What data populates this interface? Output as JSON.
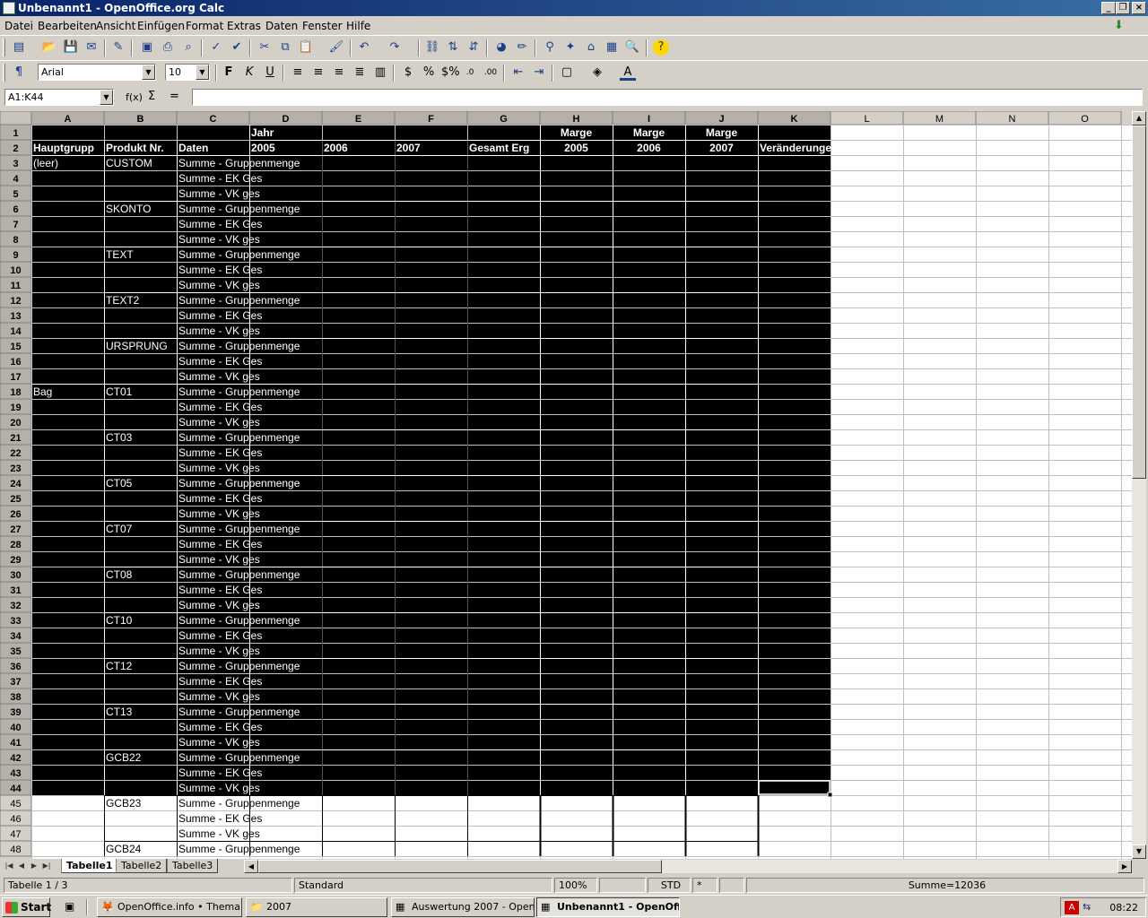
{
  "window": {
    "title": "Unbenannt1 - OpenOffice.org Calc"
  },
  "menu": [
    "Datei",
    "Bearbeiten",
    "Ansicht",
    "Einfügen",
    "Format",
    "Extras",
    "Daten",
    "Fenster",
    "Hilfe"
  ],
  "formatting": {
    "font_name": "Arial",
    "font_size": "10"
  },
  "formula_bar": {
    "name_box": "A1:K44",
    "function_wizard": "f(x)",
    "sum_symbol": "Σ",
    "equals_symbol": "=",
    "input": ""
  },
  "grid": {
    "columns": [
      "A",
      "B",
      "C",
      "D",
      "E",
      "F",
      "G",
      "H",
      "I",
      "J",
      "K",
      "L",
      "M",
      "N",
      "O"
    ],
    "rows": [
      "1",
      "2",
      "3",
      "4",
      "5",
      "6",
      "7",
      "8",
      "9",
      "10",
      "11",
      "12",
      "13",
      "14",
      "15",
      "16",
      "17",
      "18",
      "19",
      "20",
      "21",
      "22",
      "23",
      "24",
      "25",
      "26",
      "27",
      "28",
      "29",
      "30",
      "31",
      "32",
      "33",
      "34",
      "35",
      "36",
      "37",
      "38",
      "39",
      "40",
      "41",
      "42",
      "43",
      "44",
      "45",
      "46",
      "47",
      "48"
    ],
    "selection": "A1:K44",
    "header_row1": {
      "D": "Jahr",
      "H": "Marge",
      "I": "Marge",
      "J": "Marge"
    },
    "header_row2": {
      "A": "Hauptgrupp",
      "B": "Produkt Nr.",
      "C": "Daten",
      "D": "2005",
      "E": "2006",
      "F": "2007",
      "G": "Gesamt Erg",
      "H": "2005",
      "I": "2006",
      "J": "2007",
      "K": "Veränderungen"
    },
    "col_a_groups": [
      {
        "row": 3,
        "label": "(leer)"
      },
      {
        "row": 18,
        "label": "Bag"
      }
    ],
    "products": [
      {
        "row": 3,
        "label": "CUSTOM"
      },
      {
        "row": 6,
        "label": "SKONTO"
      },
      {
        "row": 9,
        "label": "TEXT"
      },
      {
        "row": 12,
        "label": "TEXT2"
      },
      {
        "row": 15,
        "label": "URSPRUNG"
      },
      {
        "row": 18,
        "label": "CT01"
      },
      {
        "row": 21,
        "label": "CT03"
      },
      {
        "row": 24,
        "label": "CT05"
      },
      {
        "row": 27,
        "label": "CT07"
      },
      {
        "row": 30,
        "label": "CT08"
      },
      {
        "row": 33,
        "label": "CT10"
      },
      {
        "row": 36,
        "label": "CT12"
      },
      {
        "row": 39,
        "label": "CT13"
      },
      {
        "row": 42,
        "label": "GCB22"
      },
      {
        "row": 45,
        "label": "GCB23"
      },
      {
        "row": 48,
        "label": "GCB24"
      }
    ],
    "data_labels": [
      "Summe - Gruppenmenge",
      "Summe - EK Ges",
      "Summe - VK ges"
    ]
  },
  "sheet_tabs": [
    "Tabelle1",
    "Tabelle2",
    "Tabelle3"
  ],
  "status": {
    "sheet": "Tabelle 1 / 3",
    "style": "Standard",
    "zoom": "100%",
    "mode": "STD",
    "modified": "*",
    "sum": "Summe=12036"
  },
  "taskbar": {
    "start": "Start",
    "tasks": [
      "OpenOffice.info • Thema ...",
      "2007",
      "Auswertung 2007 - Open...",
      "Unbenannt1 - OpenOff..."
    ],
    "clock": "08:22"
  }
}
